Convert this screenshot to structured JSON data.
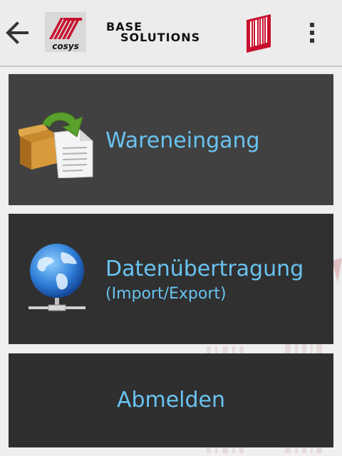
{
  "actionbar": {
    "back_icon": "arrow-left-icon",
    "logo_cosys_text": "cosys",
    "logo_base_line1": "BASE",
    "logo_base_line2": "SOLUTIONS",
    "barcode_icon": "barcode-icon",
    "overflow_icon": "more-vert-icon"
  },
  "menu": {
    "items": [
      {
        "label": "Wareneingang",
        "icon": "box-document-arrow-icon"
      },
      {
        "label": "Datenübertragung",
        "sublabel": "(Import/Export)",
        "icon": "globe-network-icon"
      },
      {
        "label": "Abmelden"
      }
    ]
  },
  "colors": {
    "accent_text": "#69c3f0",
    "tile_bg": "#3b3b3b",
    "brand_red": "#c8102e"
  }
}
